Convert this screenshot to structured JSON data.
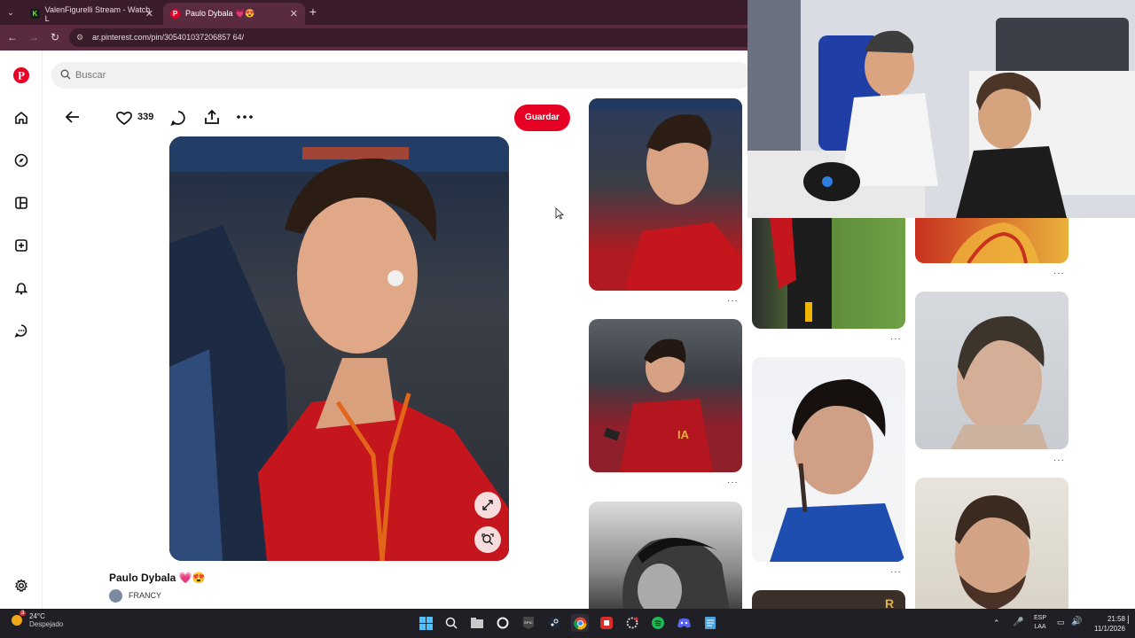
{
  "browser": {
    "tabs": [
      {
        "title": "ValenFigurelli Stream - Watch L",
        "active": false
      },
      {
        "title": "Paulo Dybala 💗😍",
        "active": true
      }
    ],
    "url": "ar.pinterest.com/pin/305401037206857 64/"
  },
  "search": {
    "placeholder": "Buscar"
  },
  "sidebar": {
    "items": [
      "pinterest-logo",
      "home-icon",
      "explore-icon",
      "boards-icon",
      "create-icon",
      "notifications-icon",
      "messages-icon",
      "settings-icon"
    ]
  },
  "pin": {
    "likes": "339",
    "save_label": "Guardar",
    "title": "Paulo Dybala 💗😍",
    "author": "FRANCY"
  },
  "grid": {
    "more_label": "···"
  },
  "taskbar": {
    "temperature": "24°C",
    "weather": "Despejado",
    "lang_top": "ESP",
    "lang_bottom": "LAA",
    "time": "21:58",
    "date": "11/1/2026",
    "notification_count": "3"
  },
  "colors": {
    "accent": "#e60023",
    "chrome": "#5a2a41",
    "taskbar": "#1f1f25"
  }
}
